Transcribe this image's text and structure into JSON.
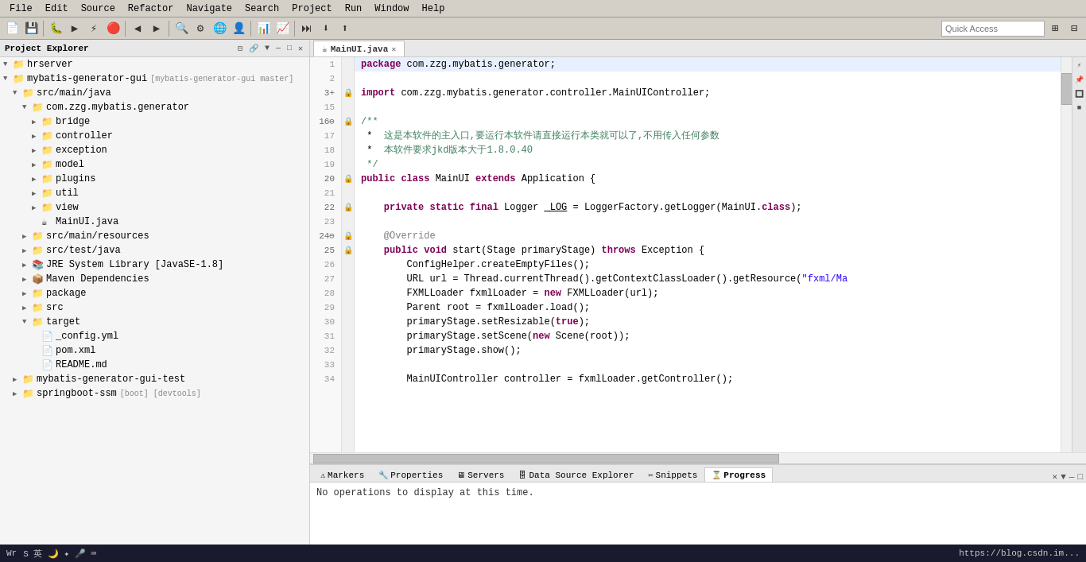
{
  "menubar": {
    "items": [
      "File",
      "Edit",
      "Source",
      "Refactor",
      "Navigate",
      "Search",
      "Project",
      "Run",
      "Window",
      "Help"
    ]
  },
  "toolbar": {
    "quick_access_placeholder": "Quick Access"
  },
  "sidebar": {
    "title": "Project Explorer",
    "tree": [
      {
        "indent": 1,
        "arrow": "▼",
        "icon": "📁",
        "label": "hrserver",
        "badge": ""
      },
      {
        "indent": 1,
        "arrow": "▼",
        "icon": "📁",
        "label": "mybatis-generator-gui",
        "badge": "[mybatis-generator-gui master]"
      },
      {
        "indent": 2,
        "arrow": "▼",
        "icon": "📁",
        "label": "src/main/java",
        "badge": ""
      },
      {
        "indent": 3,
        "arrow": "▼",
        "icon": "📁",
        "label": "com.zzg.mybatis.generator",
        "badge": ""
      },
      {
        "indent": 4,
        "arrow": "▶",
        "icon": "📁",
        "label": "bridge",
        "badge": ""
      },
      {
        "indent": 4,
        "arrow": "▶",
        "icon": "📁",
        "label": "controller",
        "badge": ""
      },
      {
        "indent": 4,
        "arrow": "▶",
        "icon": "📁",
        "label": "exception",
        "badge": ""
      },
      {
        "indent": 4,
        "arrow": "▶",
        "icon": "📁",
        "label": "model",
        "badge": ""
      },
      {
        "indent": 4,
        "arrow": "▶",
        "icon": "📁",
        "label": "plugins",
        "badge": ""
      },
      {
        "indent": 4,
        "arrow": "▶",
        "icon": "📁",
        "label": "util",
        "badge": ""
      },
      {
        "indent": 4,
        "arrow": "▶",
        "icon": "📁",
        "label": "view",
        "badge": ""
      },
      {
        "indent": 4,
        "arrow": "",
        "icon": "☕",
        "label": "MainUI.java",
        "badge": ""
      },
      {
        "indent": 3,
        "arrow": "▶",
        "icon": "📁",
        "label": "src/main/resources",
        "badge": ""
      },
      {
        "indent": 3,
        "arrow": "▶",
        "icon": "📁",
        "label": "src/test/java",
        "badge": ""
      },
      {
        "indent": 3,
        "arrow": "▶",
        "icon": "📚",
        "label": "JRE System Library [JavaSE-1.8]",
        "badge": ""
      },
      {
        "indent": 3,
        "arrow": "▶",
        "icon": "📦",
        "label": "Maven Dependencies",
        "badge": ""
      },
      {
        "indent": 3,
        "arrow": "▶",
        "icon": "📁",
        "label": "package",
        "badge": ""
      },
      {
        "indent": 3,
        "arrow": "▶",
        "icon": "📁",
        "label": "src",
        "badge": ""
      },
      {
        "indent": 3,
        "arrow": "▼",
        "icon": "📁",
        "label": "target",
        "badge": ""
      },
      {
        "indent": 4,
        "arrow": "",
        "icon": "📄",
        "label": "_config.yml",
        "badge": ""
      },
      {
        "indent": 4,
        "arrow": "",
        "icon": "📄",
        "label": "pom.xml",
        "badge": ""
      },
      {
        "indent": 4,
        "arrow": "",
        "icon": "📄",
        "label": "README.md",
        "badge": ""
      },
      {
        "indent": 2,
        "arrow": "▶",
        "icon": "📁",
        "label": "mybatis-generator-gui-test",
        "badge": ""
      },
      {
        "indent": 2,
        "arrow": "▶",
        "icon": "📁",
        "label": "springboot-ssm",
        "badge": "[boot] [devtools]"
      }
    ]
  },
  "editor": {
    "tab_label": "MainUI.java",
    "lines": [
      {
        "num": 1,
        "marker": "",
        "code_html": "<span class='kw'>package</span> com.zzg.mybatis.generator;"
      },
      {
        "num": 2,
        "marker": "",
        "code_html": ""
      },
      {
        "num": "3+",
        "marker": "🔒",
        "code_html": "<span class='kw'>import</span> com.zzg.mybatis.generator.controller.MainUIController;"
      },
      {
        "num": 15,
        "marker": "",
        "code_html": ""
      },
      {
        "num": "16⊖",
        "marker": "🔒",
        "code_html": "<span class='comment'>/**</span>"
      },
      {
        "num": 17,
        "marker": "",
        "code_html": " *  <span class='chinese'>这是本软件的主入口,要运行本软件请直接运行本类就可以了,不用传入任何参数</span>"
      },
      {
        "num": 18,
        "marker": "",
        "code_html": " *  <span class='chinese'>本软件要求jkd版本大于1.8.0.40</span>"
      },
      {
        "num": 19,
        "marker": "",
        "code_html": " <span class='comment'>*/</span>"
      },
      {
        "num": 20,
        "marker": "🔒",
        "code_html": "<span class='kw'>public</span> <span class='kw'>class</span> <span class='cls'>MainUI</span> <span class='kw'>extends</span> Application {"
      },
      {
        "num": 21,
        "marker": "",
        "code_html": ""
      },
      {
        "num": 22,
        "marker": "🔒",
        "code_html": "    <span class='kw'>private</span> <span class='kw'>static</span> <span class='kw'>final</span> Logger <span style='text-decoration:underline'>_LOG</span> = LoggerFactory.<span class='fn'>getLogger</span>(MainUI.<span class='kw'>class</span>);"
      },
      {
        "num": 23,
        "marker": "",
        "code_html": ""
      },
      {
        "num": "24⊖",
        "marker": "🔒",
        "code_html": "    <span class='ann'>@Override</span>"
      },
      {
        "num": 25,
        "marker": "🔒",
        "code_html": "    <span class='kw'>public</span> <span class='kw'>void</span> <span class='fn'>start</span>(Stage primaryStage) <span class='kw'>throws</span> Exception {"
      },
      {
        "num": 26,
        "marker": "",
        "code_html": "        ConfigHelper.<span class='fn'>createEmptyFiles</span>();"
      },
      {
        "num": 27,
        "marker": "",
        "code_html": "        URL url = Thread.<span class='fn'>currentThread</span>().<span class='fn'>getContextClassLoader</span>().<span class='fn'>getResource</span>(<span class='str'>\"fxml/Ma</span>"
      },
      {
        "num": 28,
        "marker": "",
        "code_html": "        FXMLLoader fxmlLoader = <span class='kw'>new</span> <span class='cls'>FXMLLoader</span>(url);"
      },
      {
        "num": 29,
        "marker": "",
        "code_html": "        Parent root = fxmlLoader.<span class='fn'>load</span>();"
      },
      {
        "num": 30,
        "marker": "",
        "code_html": "        primaryStage.<span class='fn'>setResizable</span>(<span class='kw'>true</span>);"
      },
      {
        "num": 31,
        "marker": "",
        "code_html": "        primaryStage.<span class='fn'>setScene</span>(<span class='kw'>new</span> Scene(root));"
      },
      {
        "num": 32,
        "marker": "",
        "code_html": "        primaryStage.<span class='fn'>show</span>();"
      },
      {
        "num": 33,
        "marker": "",
        "code_html": ""
      },
      {
        "num": 34,
        "marker": "",
        "code_html": "        MainUIController controller = fxmlLoader.<span class='fn'>getController</span>();"
      }
    ]
  },
  "bottom_panel": {
    "tabs": [
      "Markers",
      "Properties",
      "Servers",
      "Data Source Explorer",
      "Snippets",
      "Progress"
    ],
    "active_tab": "Progress",
    "content": "No operations to display at this time."
  },
  "status_bar": {
    "left": "Wr",
    "middle": "英 S 英 🌙 ✦ 🎤 💻 ⌨ 👥 👕 🏠",
    "right": "https://blog.csdn.im..."
  }
}
